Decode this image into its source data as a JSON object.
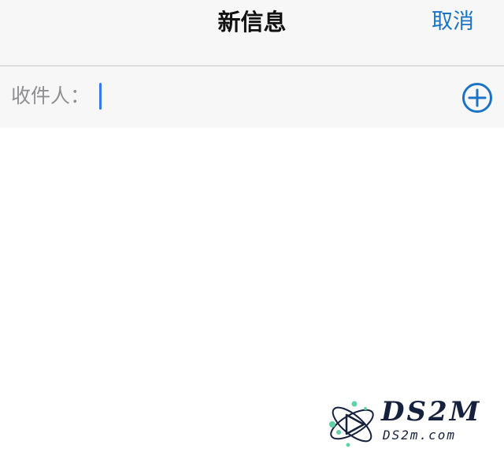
{
  "nav": {
    "title": "新信息",
    "cancel_label": "取消"
  },
  "recipient": {
    "label": "收件人：",
    "value": "",
    "add_icon": "plus-circle-icon"
  },
  "watermark": {
    "title": "DS2M",
    "url": "DS2m.com",
    "logo_icon": "atom-play-icon"
  },
  "colors": {
    "accent": "#1a73c9",
    "caret": "#3478f6",
    "label": "#8e8e93",
    "bar_bg": "#f7f7f7"
  }
}
